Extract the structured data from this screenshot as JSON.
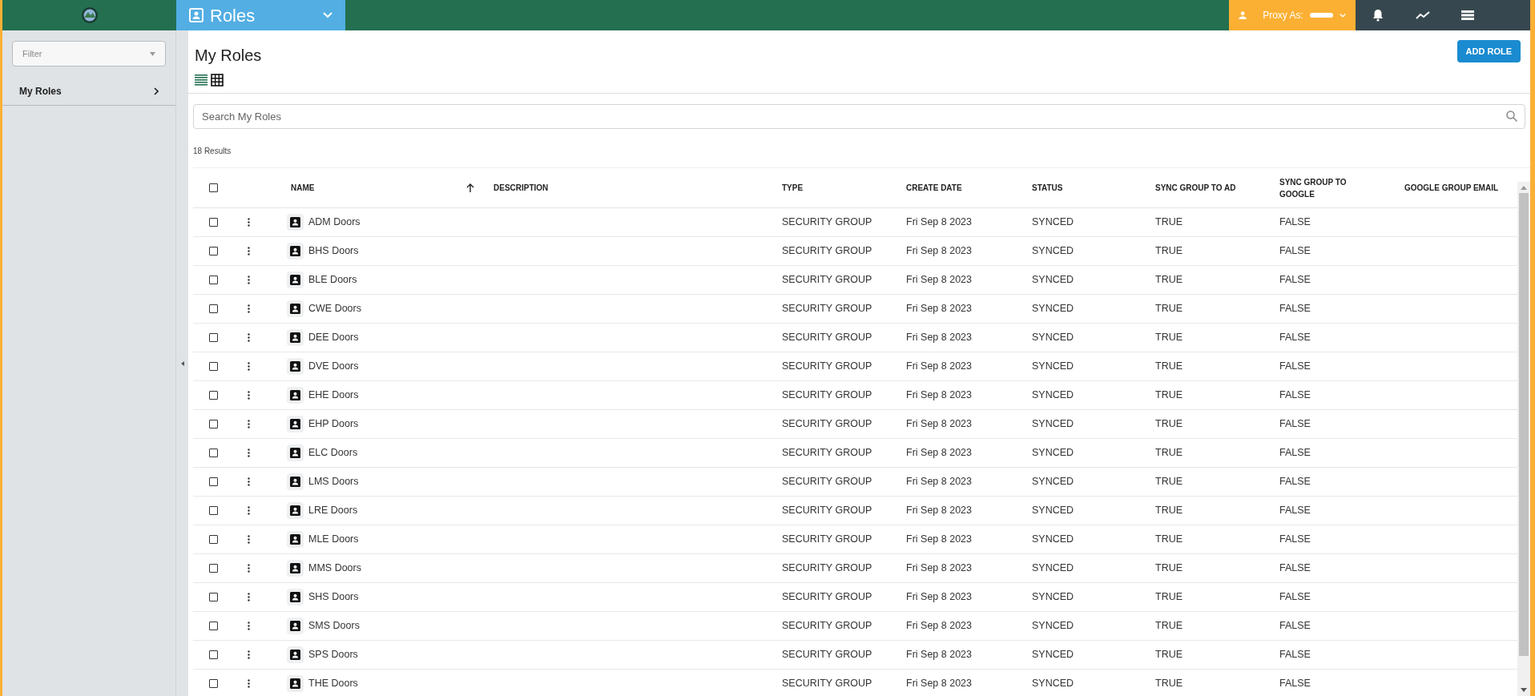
{
  "top_bar": {
    "module": "Roles",
    "proxy_label": "Proxy As:"
  },
  "sidebar": {
    "filter": {
      "placeholder": "Filter"
    },
    "items": [
      {
        "label": "My Roles",
        "selected": true
      }
    ]
  },
  "page": {
    "title": "My Roles",
    "add_button": "ADD ROLE",
    "views": [
      {
        "kind": "list",
        "selected": true
      },
      {
        "kind": "grid",
        "selected": false
      }
    ],
    "search": {
      "placeholder": "Search My Roles"
    },
    "results": "18 Results"
  },
  "table": {
    "header_checked": false,
    "columns": [
      {
        "label": "NAME",
        "sorted": true,
        "ascending": true
      },
      {
        "label": "DESCRIPTION"
      },
      {
        "label": "TYPE"
      },
      {
        "label": "CREATE DATE"
      },
      {
        "label": "STATUS"
      },
      {
        "label": "SYNC GROUP TO AD"
      },
      {
        "label": "SYNC GROUP TO GOOGLE"
      },
      {
        "label": "GOOGLE GROUP EMAIL"
      }
    ],
    "rows": [
      {
        "checked": false,
        "name": "ADM Doors",
        "type": "SECURITY GROUP",
        "create_date": "Fri Sep 8 2023",
        "status": "SYNCED",
        "sync_ad": "TRUE",
        "sync_google": "FALSE"
      },
      {
        "checked": false,
        "name": "BHS Doors",
        "type": "SECURITY GROUP",
        "create_date": "Fri Sep 8 2023",
        "status": "SYNCED",
        "sync_ad": "TRUE",
        "sync_google": "FALSE"
      },
      {
        "checked": false,
        "name": "BLE Doors",
        "type": "SECURITY GROUP",
        "create_date": "Fri Sep 8 2023",
        "status": "SYNCED",
        "sync_ad": "TRUE",
        "sync_google": "FALSE"
      },
      {
        "checked": false,
        "name": "CWE Doors",
        "type": "SECURITY GROUP",
        "create_date": "Fri Sep 8 2023",
        "status": "SYNCED",
        "sync_ad": "TRUE",
        "sync_google": "FALSE"
      },
      {
        "checked": false,
        "name": "DEE Doors",
        "type": "SECURITY GROUP",
        "create_date": "Fri Sep 8 2023",
        "status": "SYNCED",
        "sync_ad": "TRUE",
        "sync_google": "FALSE"
      },
      {
        "checked": false,
        "name": "DVE Doors",
        "type": "SECURITY GROUP",
        "create_date": "Fri Sep 8 2023",
        "status": "SYNCED",
        "sync_ad": "TRUE",
        "sync_google": "FALSE"
      },
      {
        "checked": false,
        "name": "EHE Doors",
        "type": "SECURITY GROUP",
        "create_date": "Fri Sep 8 2023",
        "status": "SYNCED",
        "sync_ad": "TRUE",
        "sync_google": "FALSE"
      },
      {
        "checked": false,
        "name": "EHP Doors",
        "type": "SECURITY GROUP",
        "create_date": "Fri Sep 8 2023",
        "status": "SYNCED",
        "sync_ad": "TRUE",
        "sync_google": "FALSE"
      },
      {
        "checked": false,
        "name": "ELC Doors",
        "type": "SECURITY GROUP",
        "create_date": "Fri Sep 8 2023",
        "status": "SYNCED",
        "sync_ad": "TRUE",
        "sync_google": "FALSE"
      },
      {
        "checked": false,
        "name": "LMS Doors",
        "type": "SECURITY GROUP",
        "create_date": "Fri Sep 8 2023",
        "status": "SYNCED",
        "sync_ad": "TRUE",
        "sync_google": "FALSE"
      },
      {
        "checked": false,
        "name": "LRE Doors",
        "type": "SECURITY GROUP",
        "create_date": "Fri Sep 8 2023",
        "status": "SYNCED",
        "sync_ad": "TRUE",
        "sync_google": "FALSE"
      },
      {
        "checked": false,
        "name": "MLE Doors",
        "type": "SECURITY GROUP",
        "create_date": "Fri Sep 8 2023",
        "status": "SYNCED",
        "sync_ad": "TRUE",
        "sync_google": "FALSE"
      },
      {
        "checked": false,
        "name": "MMS Doors",
        "type": "SECURITY GROUP",
        "create_date": "Fri Sep 8 2023",
        "status": "SYNCED",
        "sync_ad": "TRUE",
        "sync_google": "FALSE"
      },
      {
        "checked": false,
        "name": "SHS Doors",
        "type": "SECURITY GROUP",
        "create_date": "Fri Sep 8 2023",
        "status": "SYNCED",
        "sync_ad": "TRUE",
        "sync_google": "FALSE"
      },
      {
        "checked": false,
        "name": "SMS Doors",
        "type": "SECURITY GROUP",
        "create_date": "Fri Sep 8 2023",
        "status": "SYNCED",
        "sync_ad": "TRUE",
        "sync_google": "FALSE"
      },
      {
        "checked": false,
        "name": "SPS Doors",
        "type": "SECURITY GROUP",
        "create_date": "Fri Sep 8 2023",
        "status": "SYNCED",
        "sync_ad": "TRUE",
        "sync_google": "FALSE"
      },
      {
        "checked": false,
        "name": "THE Doors",
        "type": "SECURITY GROUP",
        "create_date": "Fri Sep 8 2023",
        "status": "SYNCED",
        "sync_ad": "TRUE",
        "sync_google": "FALSE"
      }
    ]
  }
}
